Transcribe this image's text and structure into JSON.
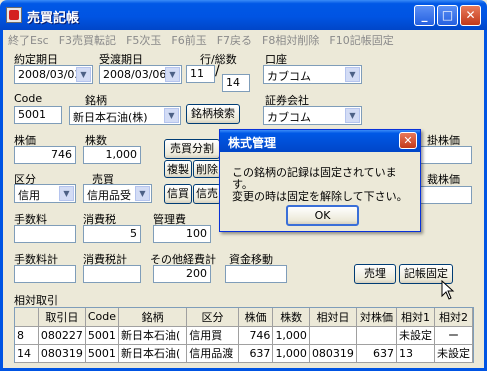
{
  "window": {
    "title": "売買記帳"
  },
  "caption_buttons": {
    "minimize": "_",
    "maximize": "□",
    "close": "✕"
  },
  "fkeys": [
    "終了Esc",
    "F3売買転記",
    "F5次玉",
    "F6前玉",
    "F7戻る",
    "F8相対削除",
    "F10記帳固定"
  ],
  "form": {
    "yakujo_label": "約定期日",
    "yakujo_value": "2008/03/03",
    "ukewatashi_label": "受渡期日",
    "ukewatashi_value": "2008/03/06",
    "gyo_label": "行/総数",
    "gyo_value": "11",
    "sosu_value": "14",
    "koza_label": "口座",
    "koza_value": "カブコム",
    "code_label": "Code",
    "code_value": "5001",
    "meigara_label": "銘柄",
    "meigara_value": "新日本石油(株)",
    "search_button": "銘柄検索",
    "shoken_label": "証券会社",
    "shoken_value": "カブコム",
    "kabuka_label": "株価",
    "kabuka_value": "746",
    "kabusu_label": "株数",
    "kabusu_value": "1,000",
    "baibai_bunkatsu_button": "売買分割",
    "fukusei_button": "複製",
    "sakujo_button": "削除",
    "kakekabuka_label": "掛株価",
    "kubun_label": "区分",
    "kubun_value": "信用",
    "baibai_label": "売買",
    "baibai_value": "信用品受",
    "shinkai_button": "信買",
    "shinbai_button": "信売",
    "saikabuka_label": "裁株価",
    "tesuryo_label": "手数料",
    "shohizei_label": "消費税",
    "shohizei_value": "5",
    "kanrihi_label": "管理費",
    "kanrihi_value": "100",
    "tesuryokei_label": "手数料計",
    "shohizeikei_label": "消費税計",
    "sonotakei_label": "その他経費計",
    "sonotakei_value": "200",
    "shikin_label": "資金移動",
    "baibai_button": "売埋",
    "kicho_kotei_button": "記帳固定",
    "aitai_label": "相対取引"
  },
  "grid": {
    "headers": [
      "",
      "取引日",
      "Code",
      "銘柄",
      "区分",
      "株価",
      "株数",
      "相対日",
      "対株価",
      "相対1",
      "相対2"
    ],
    "rows": [
      [
        "8",
        "080227",
        "5001",
        "新日本石油(",
        "信用買",
        "746",
        "1,000",
        "",
        "",
        "未設定",
        "ー"
      ],
      [
        "14",
        "080319",
        "5001",
        "新日本石油(",
        "信用品渡",
        "637",
        "1,000",
        "080319",
        "637",
        "13",
        "未設定"
      ]
    ]
  },
  "dialog": {
    "title": "株式管理",
    "message_line1": "この銘柄の記録は固定されています。",
    "message_line2": "変更の時は固定を解除して下さい。",
    "ok_label": "OK"
  },
  "colors": {
    "titlebar": "#0054e3",
    "window_bg": "#ece9d8",
    "input_border": "#7f9db9",
    "close_red": "#c2391a"
  }
}
